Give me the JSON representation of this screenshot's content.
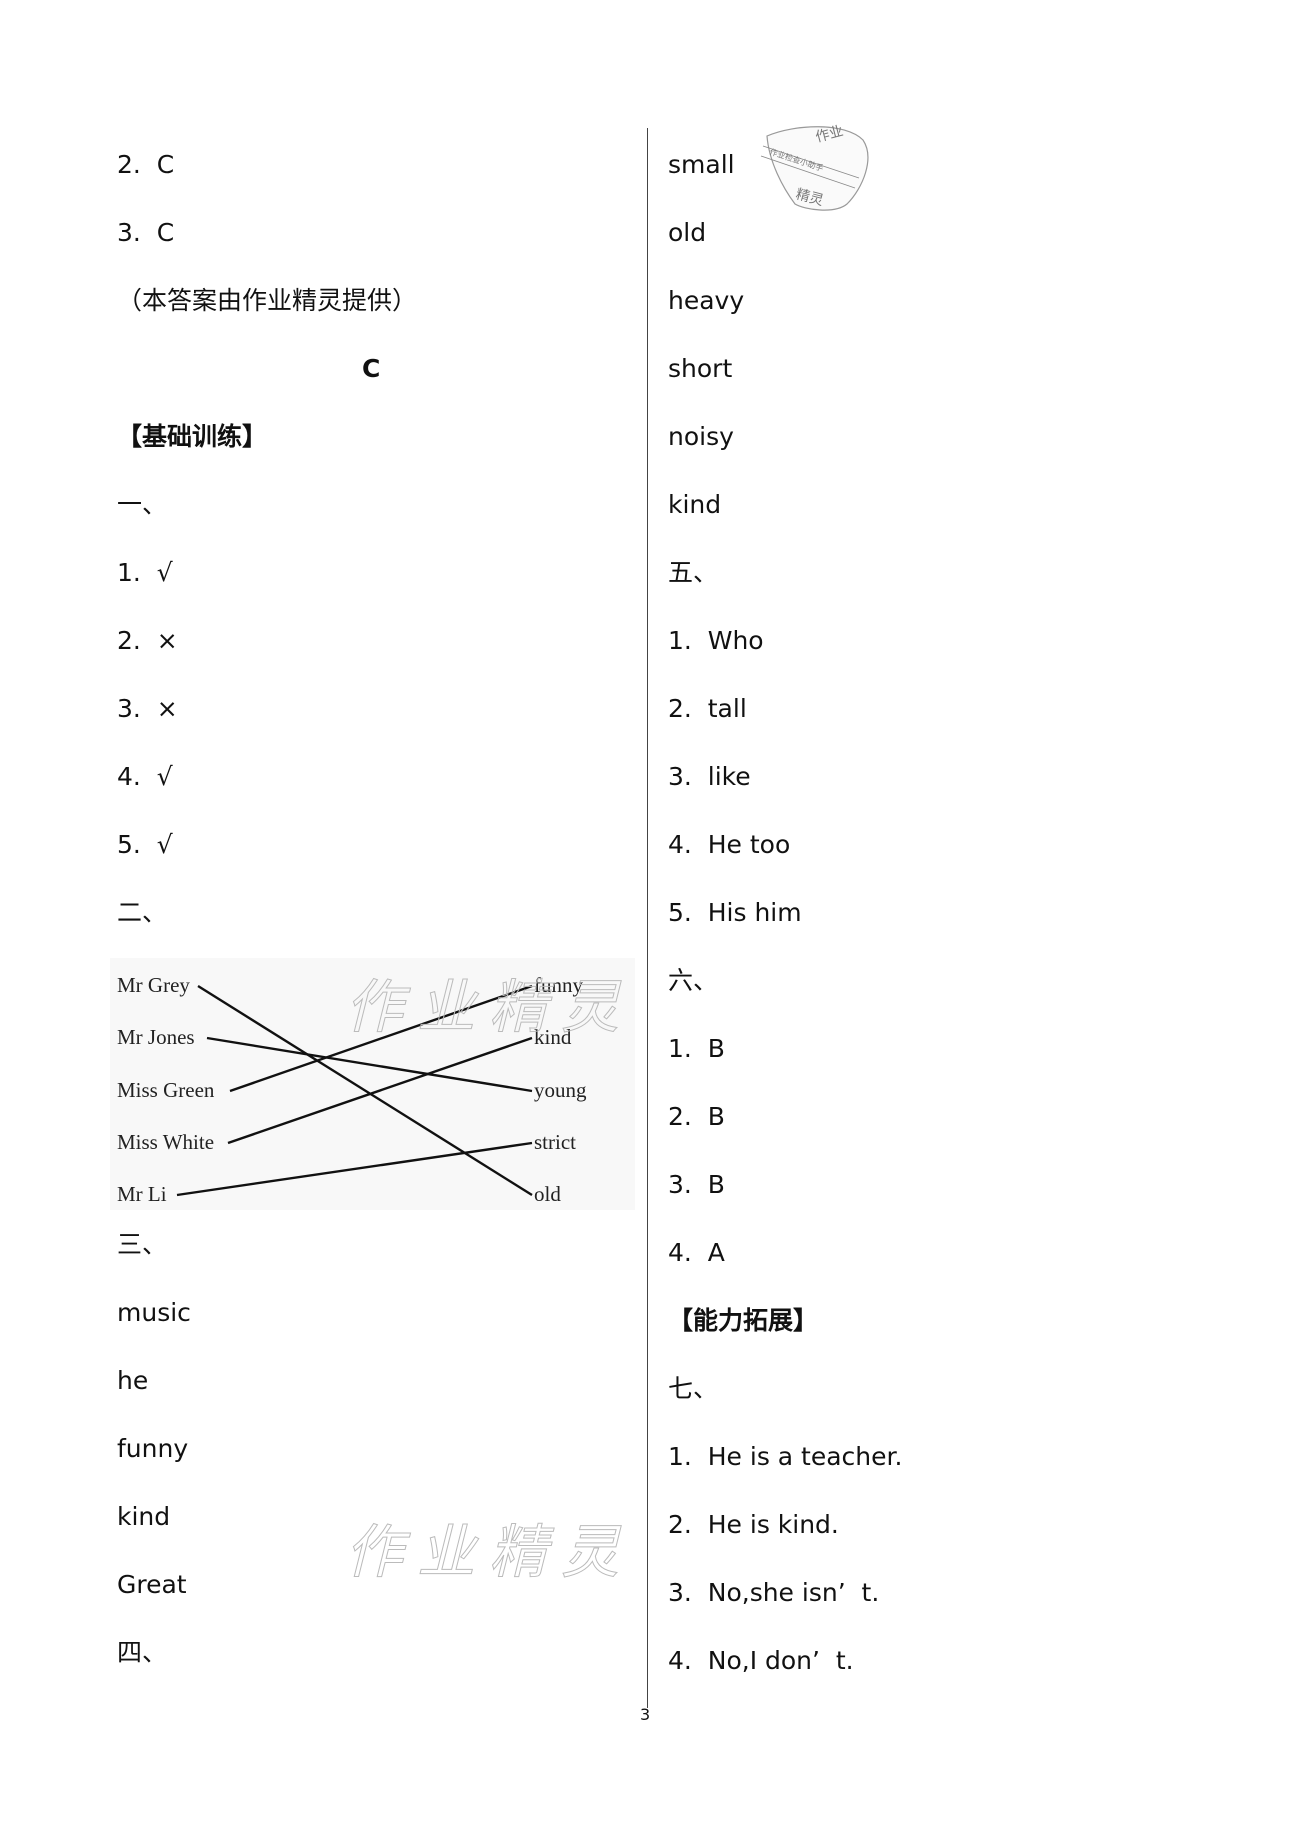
{
  "page_number": "3",
  "left_column": [
    {
      "text": "2.  C"
    },
    {
      "text": "3.  C"
    },
    {
      "text": "（本答案由作业精灵提供）"
    },
    {
      "text": "C",
      "style": "heading-center"
    },
    {
      "text": "【基础训练】",
      "style": "bold"
    },
    {
      "text": "一、"
    },
    {
      "text": "1.  √"
    },
    {
      "text": "2.  ×"
    },
    {
      "text": "3.  ×"
    },
    {
      "text": "4.  √"
    },
    {
      "text": "5.  √"
    },
    {
      "text": "二、"
    }
  ],
  "left_column_after_figure": [
    {
      "text": "三、"
    },
    {
      "text": "music"
    },
    {
      "text": "he"
    },
    {
      "text": "funny"
    },
    {
      "text": "kind"
    },
    {
      "text": "Great"
    },
    {
      "text": "四、"
    }
  ],
  "matching": {
    "left_labels": [
      "Mr Grey",
      "Mr Jones",
      "Miss Green",
      "Miss White",
      "Mr Li"
    ],
    "right_labels": [
      "funny",
      "kind",
      "young",
      "strict",
      "old"
    ],
    "connections": [
      {
        "from": "Mr Grey",
        "to": "old"
      },
      {
        "from": "Mr Jones",
        "to": "young"
      },
      {
        "from": "Miss Green",
        "to": "funny"
      },
      {
        "from": "Miss White",
        "to": "kind"
      },
      {
        "from": "Mr Li",
        "to": "strict"
      }
    ]
  },
  "right_column": [
    {
      "text": "small"
    },
    {
      "text": "old"
    },
    {
      "text": "heavy"
    },
    {
      "text": "short"
    },
    {
      "text": "noisy"
    },
    {
      "text": "kind"
    },
    {
      "text": "五、"
    },
    {
      "text": "1.  Who"
    },
    {
      "text": "2.  tall"
    },
    {
      "text": "3.  like"
    },
    {
      "text": "4.  He too"
    },
    {
      "text": "5.  His him"
    },
    {
      "text": "六、"
    },
    {
      "text": "1.  B"
    },
    {
      "text": "2.  B"
    },
    {
      "text": "3.  B"
    },
    {
      "text": "4.  A"
    },
    {
      "text": "【能力拓展】",
      "style": "bold"
    },
    {
      "text": "七、"
    },
    {
      "text": "1.  He is a teacher."
    },
    {
      "text": "2.  He is kind."
    },
    {
      "text": "3.  No,she isn’  t."
    },
    {
      "text": "4.  No,I don’  t."
    }
  ],
  "watermark": {
    "text": "作业精灵"
  },
  "stamp": {
    "top": "作业",
    "band": "作业检查小助手",
    "bottom": "精灵"
  }
}
